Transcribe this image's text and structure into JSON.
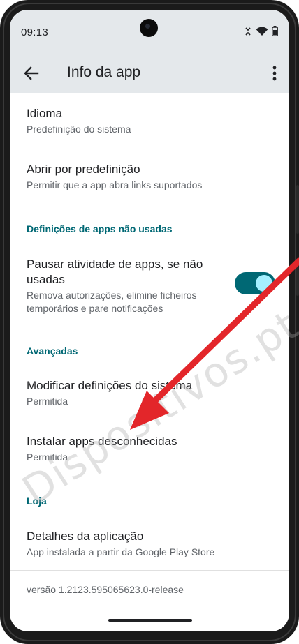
{
  "status_bar": {
    "time": "09:13"
  },
  "app_bar": {
    "title": "Info da app"
  },
  "items": [
    {
      "title": "Idioma",
      "subtitle": "Predefinição do sistema"
    },
    {
      "title": "Abrir por predefinição",
      "subtitle": "Permitir que a app abra links suportados"
    }
  ],
  "sections": {
    "unused": "Definições de apps não usadas",
    "advanced": "Avançadas",
    "store": "Loja"
  },
  "pause_item": {
    "title": "Pausar atividade de apps, se não usadas",
    "subtitle": "Remova autorizações, elimine ficheiros temporários e pare notificações",
    "enabled": true
  },
  "advanced_items": [
    {
      "title": "Modificar definições do sistema",
      "subtitle": "Permitida"
    },
    {
      "title": "Instalar apps desconhecidas",
      "subtitle": "Permitida"
    }
  ],
  "store_item": {
    "title": "Detalhes da aplicação",
    "subtitle": "App instalada a partir da Google Play Store"
  },
  "version": "versão 1.2123.595065623.0-release",
  "watermark": "Dispositivos.pt",
  "colors": {
    "accent": "#006874",
    "arrow": "#e3262a",
    "bar_bg": "#e4e8eb"
  }
}
